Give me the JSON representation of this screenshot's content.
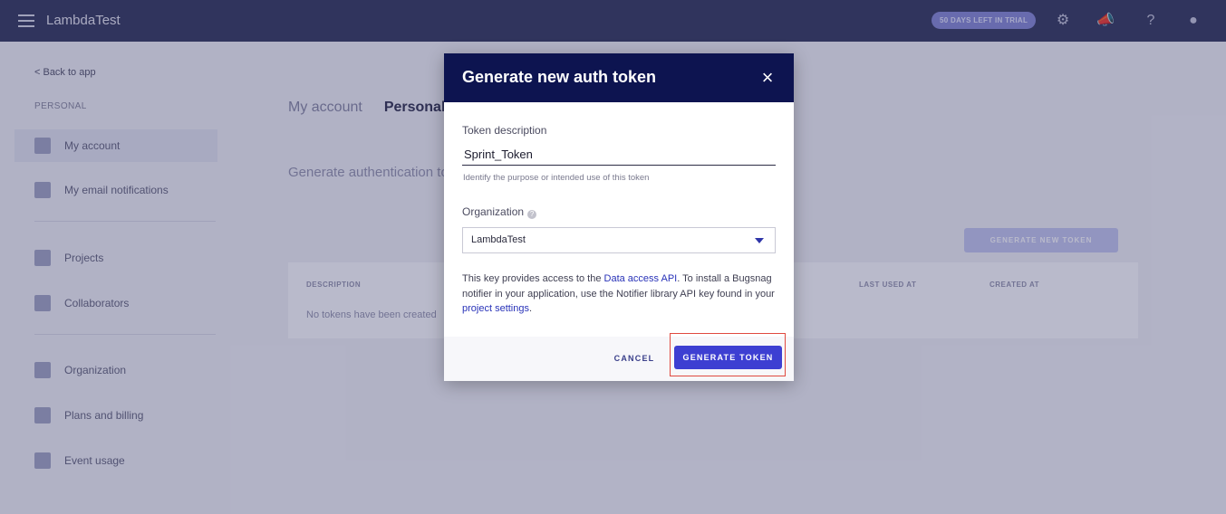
{
  "app": {
    "brand": "LambdaTest",
    "trial_badge": "50 DAYS LEFT IN TRIAL"
  },
  "sidebar": {
    "back_link": "< Back to app",
    "section_label": "PERSONAL",
    "items": [
      {
        "label": "My account"
      },
      {
        "label": "My email notifications"
      },
      {
        "label": "Projects"
      },
      {
        "label": "Collaborators"
      },
      {
        "label": "Organization"
      },
      {
        "label": "Plans and billing"
      },
      {
        "label": "Event usage"
      }
    ]
  },
  "main": {
    "breadcrumb_parent": "My account",
    "breadcrumb_current": "Personal auth tokens",
    "subtitle": "Generate authentication tokens",
    "generate_button": "GENERATE NEW TOKEN",
    "columns": [
      "DESCRIPTION",
      "LAST USED AT",
      "CREATED AT"
    ],
    "empty_text": "No tokens have been created"
  },
  "modal": {
    "title": "Generate new auth token",
    "close_symbol": "×",
    "token_label": "Token description",
    "token_value": "Sprint_Token",
    "token_hint": "Identify the purpose or intended use of this token",
    "org_label": "Organization",
    "org_help": "?",
    "org_value": "LambdaTest",
    "info_before": "This key provides access to the ",
    "info_link1": "Data access API",
    "info_middle": ". To install a Bugsnag notifier in your application, use the Notifier library API key found in your ",
    "info_link2": "project settings",
    "info_after": ".",
    "cancel_label": "CANCEL",
    "generate_label": "GENERATE TOKEN"
  }
}
